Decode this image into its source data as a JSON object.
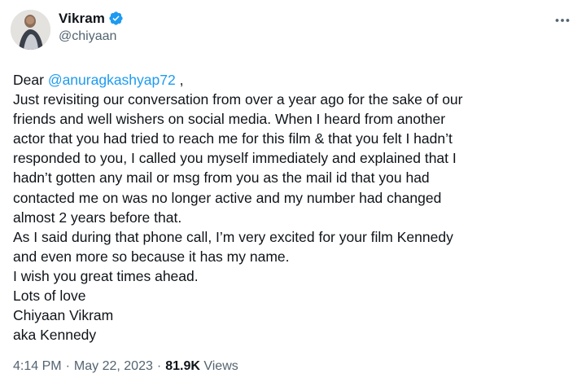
{
  "author": {
    "name": "Vikram",
    "handle": "@chiyaan",
    "verified": true
  },
  "icons": {
    "verified": "verified-badge-icon",
    "more": "more-options-icon"
  },
  "colors": {
    "link": "#1d9bf0",
    "text": "#0f1419",
    "muted": "#536471",
    "verified_badge": "#1d9bf0"
  },
  "tweet": {
    "greeting": "Dear",
    "mention": "@anuragkashyap72",
    "greeting_suffix": " ,",
    "lines": [
      "Just revisiting our conversation from over a year ago for the sake of our",
      "friends and well wishers on social media. When I heard from another",
      "actor that you had tried to reach me for this film & that you felt I hadn’t",
      "responded to you, I called you myself immediately and explained that I",
      "hadn’t gotten any mail or msg from you as the mail id that you had",
      "contacted me on was no longer active and my number had changed",
      "almost 2 years before that.",
      "As I said during that phone call, I’m very excited for your film Kennedy",
      "and even more so because it has my name.",
      "I wish you great times ahead.",
      "Lots of love",
      "Chiyaan Vikram",
      "aka Kennedy"
    ]
  },
  "meta": {
    "time": "4:14 PM",
    "separator": "·",
    "date": "May 22, 2023",
    "views_count": "81.9K",
    "views_label": "Views"
  }
}
